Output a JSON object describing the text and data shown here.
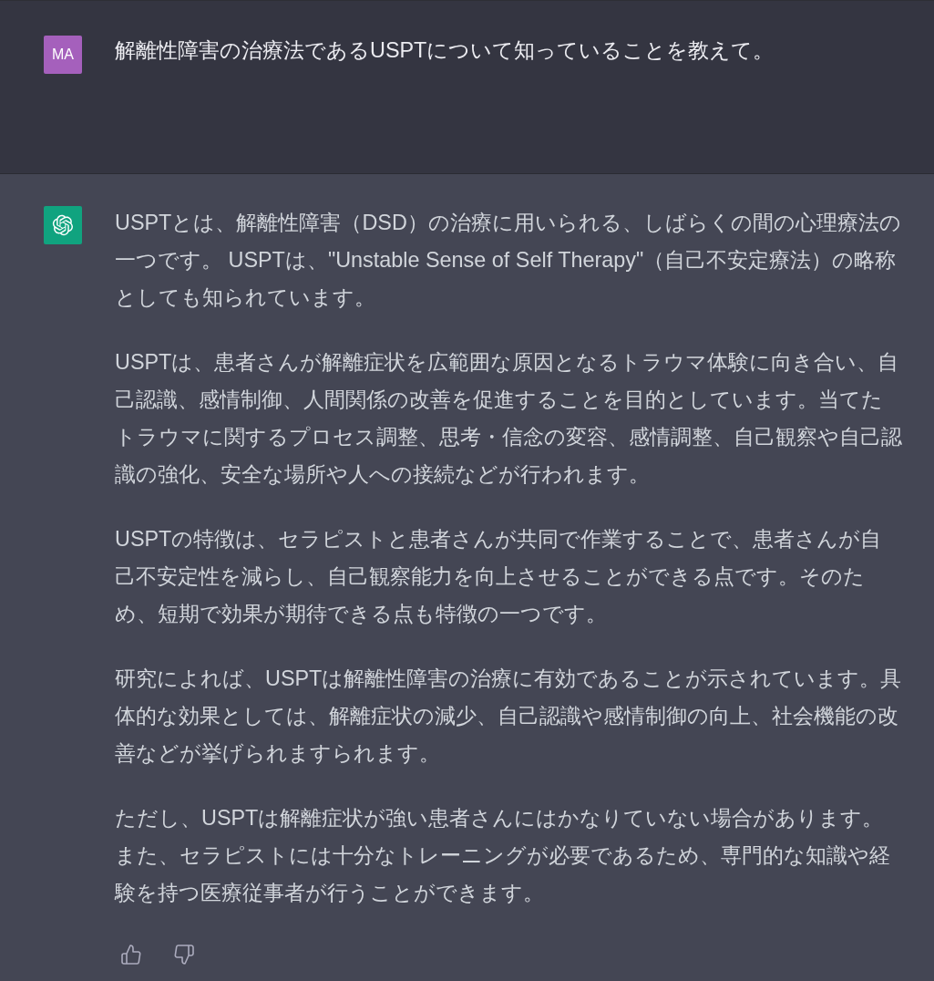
{
  "conversation": [
    {
      "kind": "user",
      "avatar": "MA",
      "paragraphs": [
        "解離性障害の治療法であるUSPTについて知っていることを教えて。"
      ]
    },
    {
      "kind": "assistant",
      "paragraphs": [
        "USPTとは、解離性障害（DSD）の治療に用いられる、しばらくの間の心理療法の一つです。 USPTは、\"Unstable Sense of Self Therapy\"（自己不安定療法）の略称としても知られています。",
        "USPTは、患者さんが解離症状を広範囲な原因となるトラウマ体験に向き合い、自己認識、感情制御、人間関係の改善を促進することを目的としています。当てたトラウマに関するプロセス調整、思考・信念の変容、感情調整、自己観察や自己認識の強化、安全な場所や人への接続などが行われます。",
        "USPTの特徴は、セラピストと患者さんが共同で作業することで、患者さんが自己不安定性を減らし、自己観察能力を向上させることができる点です。そのため、短期で効果が期待できる点も特徴の一つです。",
        "研究によれば、USPTは解離性障害の治療に有効であることが示されています。具体的な効果としては、解離症状の減少、自己認識や感情制御の向上、社会機能の改善などが挙げられますられます。",
        "ただし、USPTは解離症状が強い患者さんにはかなりていない場合があります。また、セラピストには十分なトレーニングが必要であるため、専門的な知識や経験を持つ医療従事者が行うことができます。"
      ]
    }
  ]
}
